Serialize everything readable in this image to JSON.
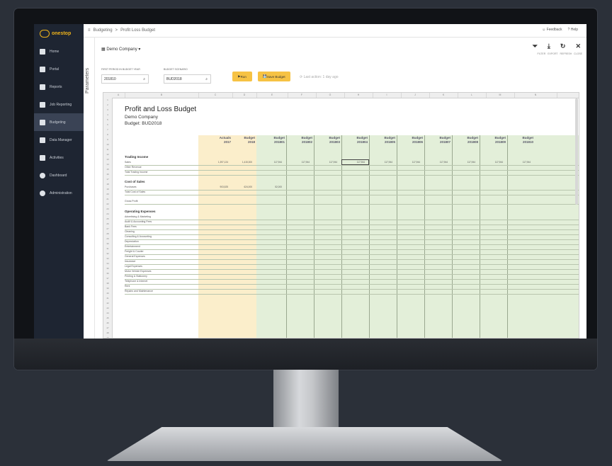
{
  "sidebar": {
    "logo_text": "onestop",
    "logo_sub": "REPORTING",
    "items": [
      {
        "label": "Home"
      },
      {
        "label": "Portal"
      },
      {
        "label": "Reports"
      },
      {
        "label": "Job Reporting"
      },
      {
        "label": "Budgeting"
      },
      {
        "label": "Data Manager"
      },
      {
        "label": "Activities"
      },
      {
        "label": "Dashboard"
      },
      {
        "label": "Administration"
      }
    ]
  },
  "header": {
    "breadcrumb": [
      "Budgeting",
      "Profit Loss Budget"
    ],
    "separator": ">",
    "right_items": [
      "Feedback",
      "Help"
    ]
  },
  "params": {
    "label": "Parameters",
    "company": "Demo Company",
    "field1_label": "FIRST PERIOD IN BUDGET YEAR",
    "field1_value": "201810",
    "field2_label": "BUDGET SCENARIO",
    "field2_value": "BUD2018",
    "run_button": "Run",
    "save_button": "Save Budget",
    "last_action": "Last action: 1 day ago"
  },
  "toolbar": {
    "labels": [
      "FILTER",
      "EXPORT",
      "REFRESH",
      "CLOSE"
    ]
  },
  "sheet": {
    "col_letters": [
      "A",
      "B",
      "C",
      "D",
      "E",
      "F",
      "G",
      "H",
      "I",
      "J",
      "K",
      "L",
      "M",
      "N"
    ],
    "title": "Profit and Loss Budget",
    "company": "Demo Company",
    "budget": "Budget: BUD2018",
    "headers": [
      {
        "top": "Actuals",
        "bottom": "2017"
      },
      {
        "top": "Budget",
        "bottom": "2018"
      },
      {
        "top": "Budget",
        "bottom": "201801"
      },
      {
        "top": "Budget",
        "bottom": "201802"
      },
      {
        "top": "Budget",
        "bottom": "201803"
      },
      {
        "top": "Budget",
        "bottom": "201804"
      },
      {
        "top": "Budget",
        "bottom": "201805"
      },
      {
        "top": "Budget",
        "bottom": "201806"
      },
      {
        "top": "Budget",
        "bottom": "201807"
      },
      {
        "top": "Budget",
        "bottom": "201808"
      },
      {
        "top": "Budget",
        "bottom": "201809"
      },
      {
        "top": "Budget",
        "bottom": "201810"
      }
    ],
    "sections": {
      "trading": "Trading Income",
      "cost": "Cost of Sales",
      "opex": "Operating Expenses"
    },
    "trading_rows": [
      "Sales",
      "Other Revenue",
      "Total Trading Income"
    ],
    "cost_rows": [
      "Purchases",
      "Total Cost of Sales"
    ],
    "gross_profit": "Gross Profit",
    "opex_rows": [
      "Advertising & Marketing",
      "Audit & Accounting Fees",
      "Bank Fees",
      "Cleaning",
      "Consulting & Accounting",
      "Depreciation",
      "Entertainment",
      "Freight & Courier",
      "General Expenses",
      "Insurance",
      "Legal Expenses",
      "Motor Vehicle Expenses",
      "Printing & Stationery",
      "Telephone & Internet",
      "Rent",
      "Repairs and Maintenance"
    ],
    "sample_values": {
      "sales": [
        "1,397,124",
        "1,415,300",
        "117,944",
        "117,944",
        "117,944",
        "117,944",
        "117,944",
        "117,944",
        "117,944",
        "117,944",
        "117,944",
        "117,944"
      ],
      "purchases": [
        "903,525",
        "624,000",
        "52,000"
      ]
    }
  }
}
